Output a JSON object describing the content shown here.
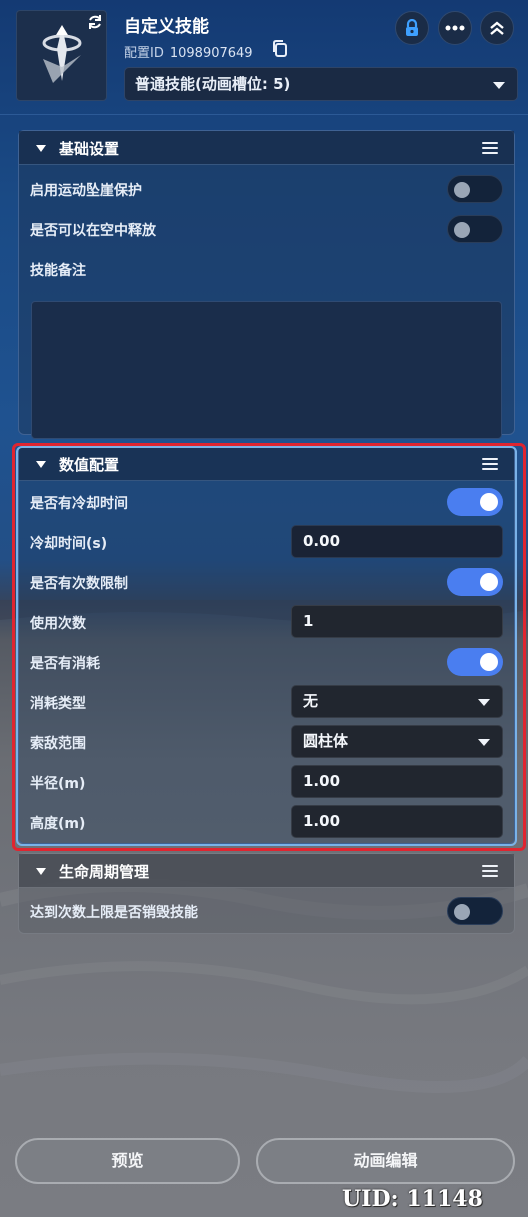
{
  "header": {
    "title": "自定义技能",
    "config_id_label": "配置ID",
    "config_id": "1098907649",
    "skill_type": "普通技能(动画槽位: 5)"
  },
  "panels": {
    "basic": {
      "title": "基础设置",
      "rows": [
        {
          "label": "启用运动坠崖保护",
          "toggle": false
        },
        {
          "label": "是否可以在空中释放",
          "toggle": false
        }
      ],
      "notes_label": "技能备注",
      "notes_value": ""
    },
    "numeric": {
      "title": "数值配置",
      "has_cooldown": {
        "label": "是否有冷却时间",
        "toggle": true
      },
      "cooldown": {
        "label": "冷却时间(s)",
        "value": "0.00"
      },
      "has_limit": {
        "label": "是否有次数限制",
        "toggle": true
      },
      "use_count": {
        "label": "使用次数",
        "value": "1"
      },
      "has_cost": {
        "label": "是否有消耗",
        "toggle": true
      },
      "cost_type": {
        "label": "消耗类型",
        "value": "无"
      },
      "search_range": {
        "label": "索敌范围",
        "value": "圆柱体"
      },
      "radius": {
        "label": "半径(m)",
        "value": "1.00"
      },
      "height": {
        "label": "高度(m)",
        "value": "1.00"
      }
    },
    "lifecycle": {
      "title": "生命周期管理",
      "rows": [
        {
          "label": "达到次数上限是否销毁技能",
          "toggle": false
        }
      ]
    }
  },
  "footer": {
    "preview_label": "预览",
    "anim_edit_label": "动画编辑",
    "uid": "UID: 11148"
  },
  "colors": {
    "accent": "#4a7ef0",
    "highlight": "#e02530"
  }
}
